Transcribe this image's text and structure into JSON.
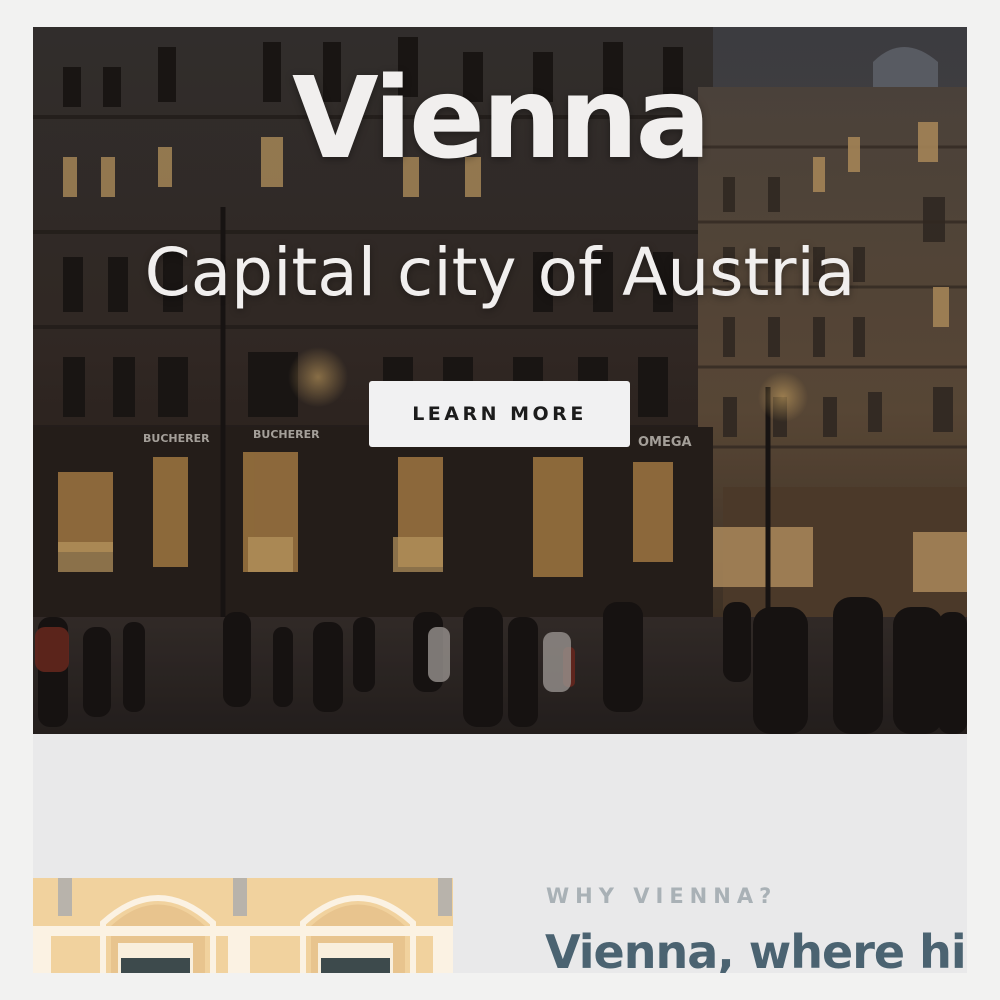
{
  "hero": {
    "title": "Vienna",
    "subtitle": "Capital city of Austria",
    "button_label": "LEARN MORE",
    "storefront_signs": [
      "BUCHERER",
      "BUCHERER",
      "OMEGA"
    ]
  },
  "section": {
    "eyebrow": "WHY VIENNA?",
    "heading": "Vienna, where history meets"
  },
  "colors": {
    "page_background": "#f2f2f1",
    "section_background": "#e9e9ea",
    "hero_text": "#f1efee",
    "button_background": "#f1f1f2",
    "button_text": "#1c1c1c",
    "eyebrow": "#a9b1b6",
    "heading": "#4b6371"
  }
}
